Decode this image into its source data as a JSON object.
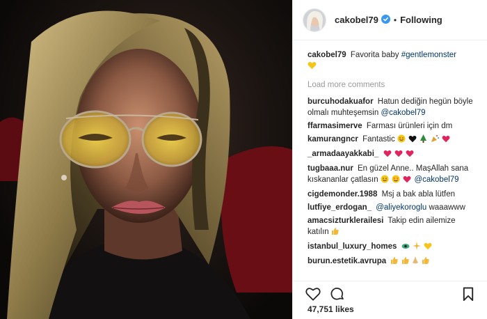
{
  "header": {
    "username": "cakobel79",
    "separator": "•",
    "follow_label": "Following"
  },
  "caption": {
    "username": "cakobel79",
    "text": "Favorita baby",
    "hashtag": "#gentlemonster"
  },
  "load_more": "Load more comments",
  "comments": [
    {
      "username": "burcuhodakuafor",
      "text": "Hatun dediğin hegün böyle olmalı muhteşemsin",
      "mention": "@cakobel79"
    },
    {
      "username": "ffarmasimerve",
      "text": "Farması ürünleri için dm"
    },
    {
      "username": "kamurangncr",
      "text": "Fantastic"
    },
    {
      "username": "_armadaayakkabi_",
      "text": ""
    },
    {
      "username": "tugbaaa.nur",
      "text": "En güzel Anne.. MaşAllah sana kıskananlar çatlasın",
      "mention": "@cakobel79"
    },
    {
      "username": "cigdemonder.1988",
      "text": "Msj a bak abla lütfen"
    },
    {
      "username": "lutfiye_erdogan_",
      "text": "",
      "mention": "@aliyekoroglu",
      "after": "waaawww"
    },
    {
      "username": "amacsizturklerailesi",
      "text": "Takip edin ailemize katılın"
    },
    {
      "username": "istanbul_luxury_homes",
      "text": ""
    },
    {
      "username": "burun.estetik.avrupa",
      "text": ""
    }
  ],
  "likes": "47,751 likes",
  "icons": {
    "like": "heart-outline-icon",
    "comment": "comment-bubble-icon",
    "save": "bookmark-icon",
    "verified": "verified-badge-icon"
  },
  "colors": {
    "link": "#003569",
    "verified": "#3897f0",
    "muted": "#999999",
    "text": "#262626"
  }
}
